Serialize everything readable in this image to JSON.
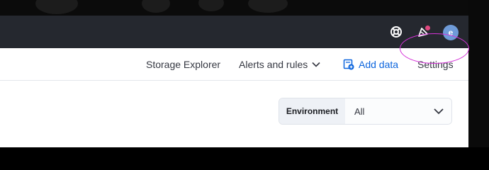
{
  "header": {
    "icons": [
      "help-icon",
      "newsfeed-icon"
    ],
    "user_avatar_initial": "e",
    "avatar_color": "#6f9bd8",
    "notification_color": "#e0487f"
  },
  "nav": {
    "storage_explorer": "Storage Explorer",
    "alerts_and_rules": "Alerts and rules",
    "add_data": "Add data",
    "settings": "Settings"
  },
  "filter": {
    "label": "Environment",
    "value": "All"
  },
  "colors": {
    "header_bg": "#25282f",
    "link_blue": "#0b64dd",
    "highlight": "#d533d8"
  }
}
